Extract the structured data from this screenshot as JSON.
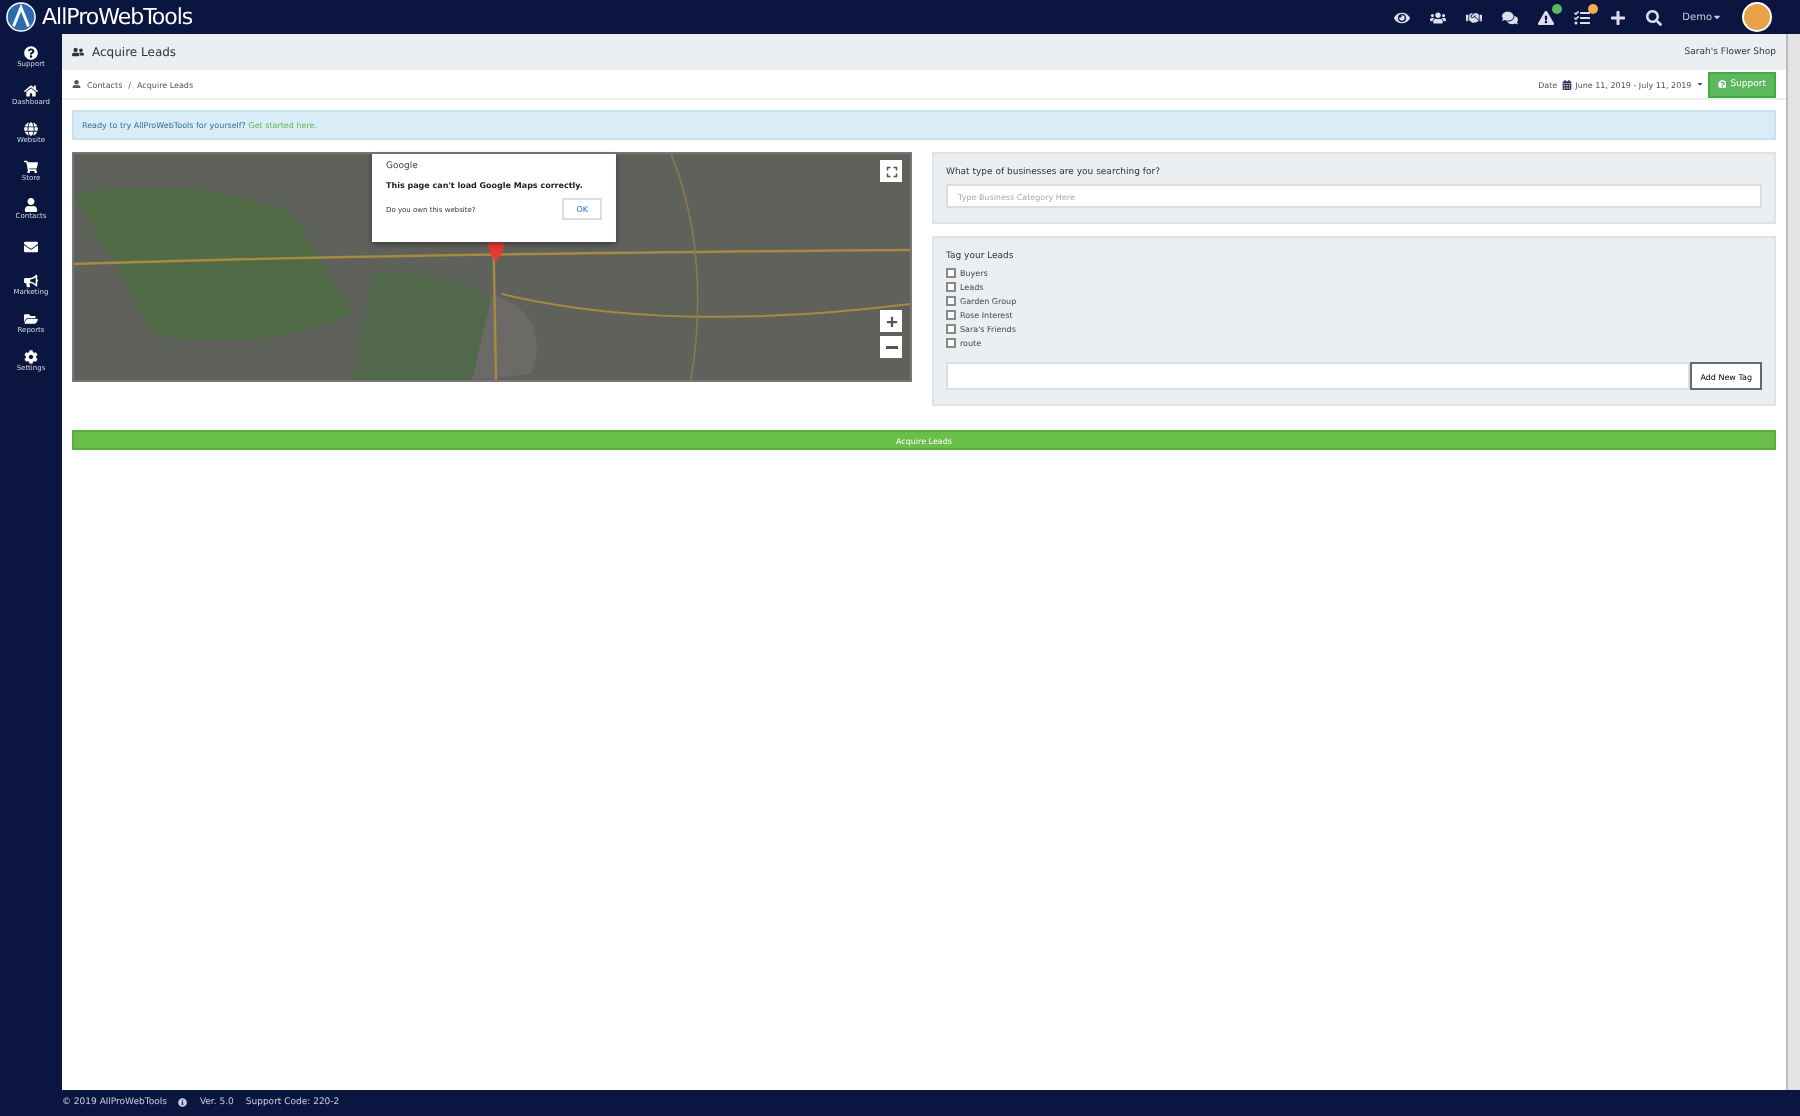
{
  "brand": "AllProWebTools",
  "sidebar": [
    {
      "kind": "question",
      "label": "Support"
    },
    {
      "kind": "home",
      "label": "Dashboard"
    },
    {
      "kind": "globe",
      "label": "Website"
    },
    {
      "kind": "cart",
      "label": "Store"
    },
    {
      "kind": "user",
      "label": "Contacts"
    },
    {
      "kind": "envelope"
    },
    {
      "kind": "bullhorn",
      "label": "Marketing"
    },
    {
      "kind": "folder",
      "label": "Reports"
    },
    {
      "kind": "gear",
      "label": "Settings"
    }
  ],
  "topbar": {
    "icons": [
      {
        "kind": "eye"
      },
      {
        "kind": "users"
      },
      {
        "kind": "handshake"
      },
      {
        "kind": "chat"
      },
      {
        "kind": "warning",
        "badge": true
      },
      {
        "kind": "tasks",
        "badge": true
      },
      {
        "kind": "plus"
      },
      {
        "kind": "search"
      }
    ],
    "user": "Demo"
  },
  "page": {
    "title": "Acquire Leads",
    "company": "Sarah's Flower Shop",
    "breadcrumb": [
      "Contacts",
      "Acquire Leads"
    ],
    "breadcrumb_separator": "/",
    "date_label": "Date",
    "date_range": "June 11, 2019 - July 11, 2019",
    "support": "Support"
  },
  "alert": {
    "text": "Ready to try AllProWebTools for yourself?",
    "link": "Get started here."
  },
  "map_dialog": {
    "title": "Google",
    "message": "This page can't load Google Maps correctly.",
    "question": "Do you own this website?",
    "ok": "OK"
  },
  "search": {
    "label": "What type of businesses are you searching for?",
    "placeholder": "Type Business Category Here"
  },
  "tags": {
    "title": "Tag your Leads",
    "items": [
      {
        "label": "Buyers",
        "checked": false
      },
      {
        "label": "Leads",
        "checked": false
      },
      {
        "label": "Garden Group",
        "checked": false
      },
      {
        "label": "Rose Interest",
        "checked": false
      },
      {
        "label": "Sara's Friends",
        "checked": false
      },
      {
        "label": "route",
        "checked": false
      }
    ],
    "add": "Add New Tag"
  },
  "action": "Acquire Leads",
  "footer": {
    "copyright": "© 2019 AllProWebTools",
    "version": "Ver. 5.0",
    "support_code": "Support Code: 220-2"
  }
}
